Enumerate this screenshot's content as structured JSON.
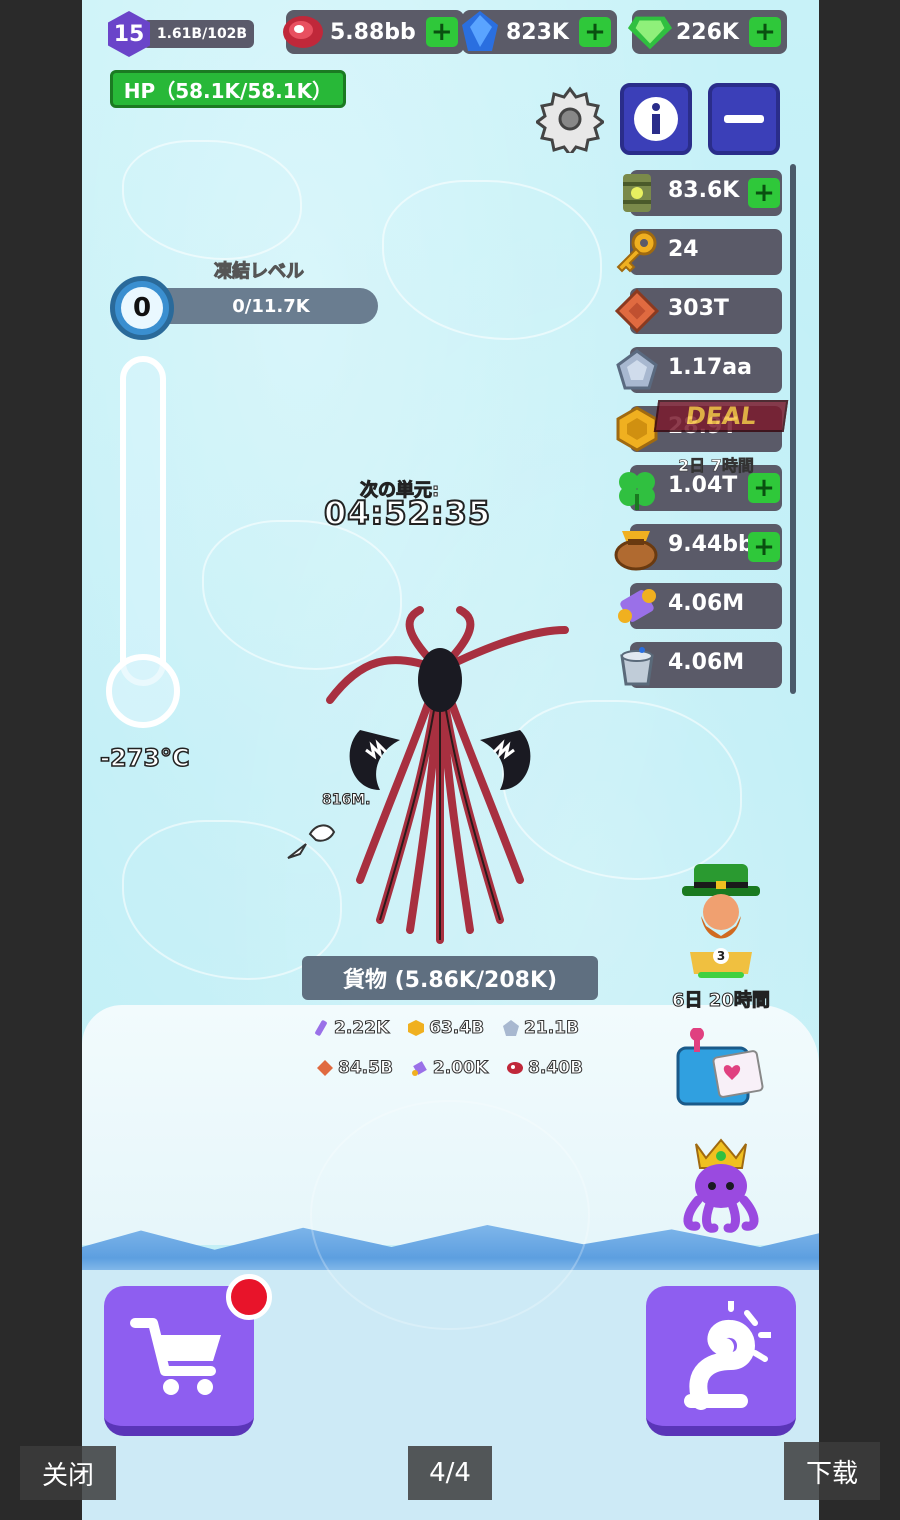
{
  "player": {
    "level": "15",
    "xp": "1.61B/102B"
  },
  "top_resources": [
    {
      "name": "meat",
      "icon": "meat-icon",
      "value": "5.88bb"
    },
    {
      "name": "sapphire",
      "icon": "blue-gem-icon",
      "value": "823K"
    },
    {
      "name": "emerald",
      "icon": "green-gem-icon",
      "value": "226K"
    }
  ],
  "hp": "HP（58.1K/58.1K）",
  "freeze": {
    "title": "凍結レベル",
    "level": "0",
    "progress": "0/11.7K",
    "temperature": "-273°C"
  },
  "timer": {
    "label": "次の単元:",
    "value": "04:52:35"
  },
  "side_resources": [
    {
      "icon": "toxic-barrel-icon",
      "value": "83.6K",
      "plus": true
    },
    {
      "icon": "key-icon",
      "value": "24",
      "plus": false
    },
    {
      "icon": "copper-plate-icon",
      "value": "303T",
      "plus": false
    },
    {
      "icon": "silver-pentagon-icon",
      "value": "1.17aa",
      "plus": false
    },
    {
      "icon": "gold-hexagon-icon",
      "value": "28.9T",
      "plus": false
    },
    {
      "icon": "clover-icon",
      "value": "1.04T",
      "plus": true
    },
    {
      "icon": "money-bag-icon",
      "value": "9.44bb",
      "plus": true
    },
    {
      "icon": "scroll-icon",
      "value": "4.06M",
      "plus": false
    },
    {
      "icon": "bucket-icon",
      "value": "4.06M",
      "plus": false
    }
  ],
  "deal": {
    "label": "DEAL",
    "time": "2日 7時間"
  },
  "monster": {
    "distance": "816M."
  },
  "cargo": {
    "title": "貨物 (5.86K/208K)",
    "row1": [
      {
        "icon": "vial-icon",
        "value": "2.22K"
      },
      {
        "icon": "gold-hexagon-icon",
        "value": "63.4B"
      },
      {
        "icon": "silver-pentagon-icon",
        "value": "21.1B"
      }
    ],
    "row2": [
      {
        "icon": "copper-plate-icon",
        "value": "84.5B"
      },
      {
        "icon": "scroll-icon",
        "value": "2.00K"
      },
      {
        "icon": "meat-icon",
        "value": "8.40B"
      }
    ]
  },
  "leprechaun": {
    "badge": "3",
    "time": "6日 20時間"
  },
  "viewer": {
    "close": "关闭",
    "page": "4/4",
    "download": "下载"
  },
  "colors": {
    "accent": "#8e5ef0",
    "plus": "#2fc83a",
    "hp": "#28b838",
    "info": "#3b3fb8"
  }
}
